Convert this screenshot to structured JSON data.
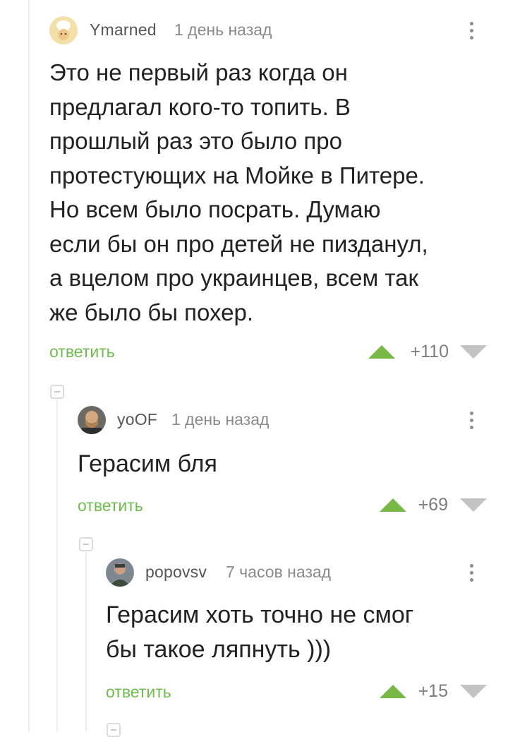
{
  "comments": [
    {
      "username": "Ymarned",
      "time": "1 день назад",
      "text": "Это не первый раз когда он\nпредлагал кого-то топить. В\nпрошлый раз это было про\nпротестующих на Мойке в Питере.\nНо всем было посрать. Думаю\nесли бы он про детей не пизданул,\nа вцелом про украинцев, всем так\nже было бы похер.",
      "reply_label": "ответить",
      "score": "+110",
      "avatar_icon": "chef-avatar-icon"
    },
    {
      "username": "yoOF",
      "time": "1 день назад",
      "text": "Герасим бля",
      "reply_label": "ответить",
      "score": "+69",
      "avatar_icon": "user-photo-avatar"
    },
    {
      "username": "popovsv",
      "time": "7 часов назад",
      "text": "Герасим хоть точно не смог\nбы такое ляпнуть )))",
      "reply_label": "ответить",
      "score": "+15",
      "avatar_icon": "user-photo-avatar"
    }
  ],
  "colors": {
    "accent_green": "#6fbc4c",
    "upvote": "#7ab846",
    "downvote": "#c3c3c3"
  }
}
